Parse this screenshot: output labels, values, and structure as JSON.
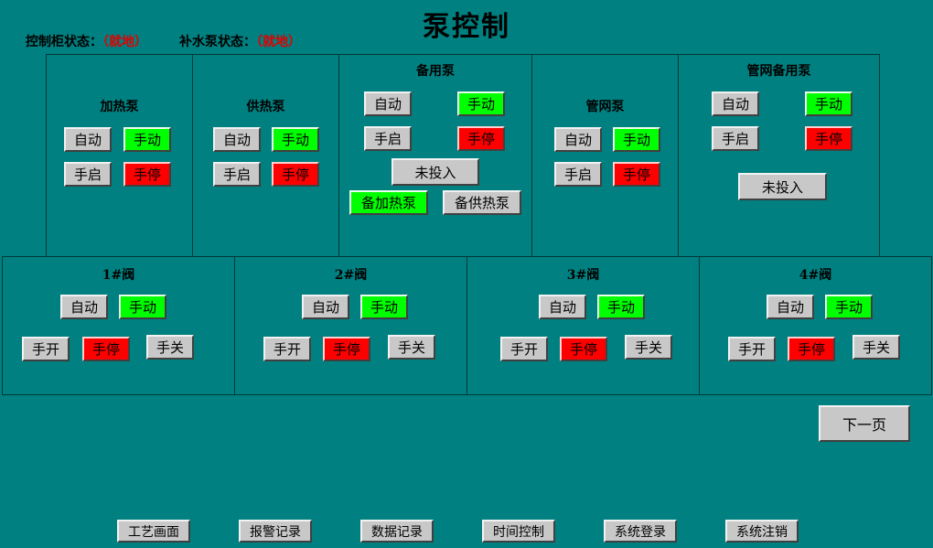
{
  "title": "泵控制",
  "status": {
    "cabinet_label": "控制柜状态：",
    "cabinet_value": "（就地）",
    "refill_label": "补水泵状态：",
    "refill_value": "（就地）"
  },
  "buttons": {
    "auto": "自动",
    "manual": "手动",
    "manual_start": "手启",
    "manual_stop": "手停",
    "not_engaged": "未投入",
    "backup_heating": "备加热泵",
    "backup_supply": "备供热泵",
    "manual_open": "手开",
    "manual_close": "手关",
    "next_page": "下一页"
  },
  "pumps": {
    "heating": "加热泵",
    "supply": "供热泵",
    "backup": "备用泵",
    "network": "管网泵",
    "network_backup": "管网备用泵"
  },
  "valves": [
    "1#阀",
    "2#阀",
    "3#阀",
    "4#阀"
  ],
  "nav": [
    "工艺画面",
    "报警记录",
    "数据记录",
    "时间控制",
    "系统登录",
    "系统注销"
  ],
  "colors": {
    "background": "#008080",
    "active_green": "#00ff00",
    "stop_red": "#ff0000",
    "button_gray": "#c8c8c8",
    "status_red": "#e00000"
  }
}
